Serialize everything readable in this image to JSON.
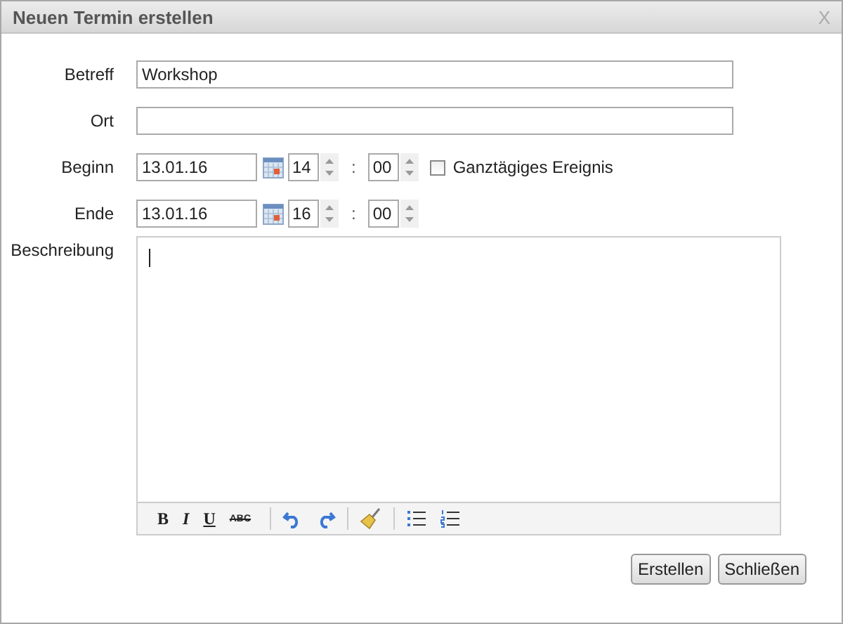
{
  "window": {
    "title": "Neuen Termin erstellen",
    "close": "X"
  },
  "fields": [
    {
      "label": "Betreff",
      "value": "Workshop"
    },
    {
      "label": "Ort"
    }
  ],
  "times": [
    {
      "label": "Beginn",
      "date": "13.01.16",
      "hour": "14",
      "minute": "00",
      "separator": ":",
      "allday": {
        "label": "Ganztägiges Ereignis",
        "checked": false
      }
    },
    {
      "label": "Ende",
      "date": "13.01.16",
      "hour": "16",
      "minute": "00",
      "separator": ":"
    }
  ],
  "description": {
    "label": "Beschreibung"
  },
  "toolbar": [
    {
      "kind": "bold",
      "label": "B"
    },
    {
      "kind": "italic",
      "label": "I"
    },
    {
      "kind": "underline",
      "label": "U"
    },
    {
      "kind": "strike",
      "label": "ABC"
    },
    {
      "kind": "sep"
    },
    {
      "kind": "undo"
    },
    {
      "kind": "redo"
    },
    {
      "kind": "sep"
    },
    {
      "kind": "clean"
    },
    {
      "kind": "sep"
    },
    {
      "kind": "bullets"
    },
    {
      "kind": "numbers"
    }
  ],
  "buttons": [
    "Erstellen",
    "Schließen"
  ]
}
